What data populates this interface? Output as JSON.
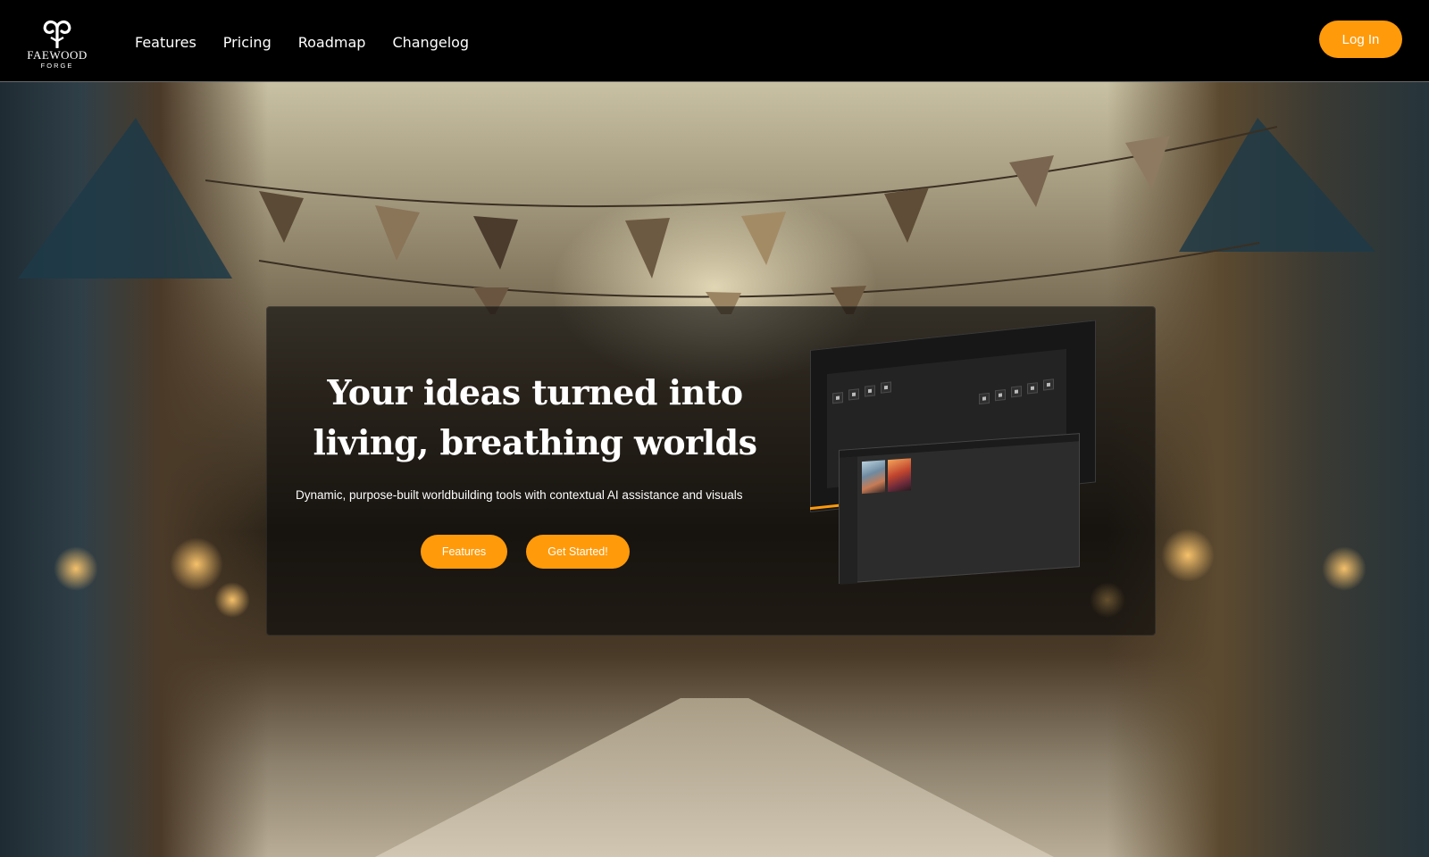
{
  "brand": {
    "name": "Faewood",
    "sub": "Forge"
  },
  "nav": {
    "links": [
      "Features",
      "Pricing",
      "Roadmap",
      "Changelog"
    ],
    "login_label": "Log In"
  },
  "hero": {
    "headline": "Your ideas turned into living, breathing worlds",
    "subheadline": "Dynamic, purpose-built worldbuilding tools with contextual AI assistance and visuals",
    "features_button": "Features",
    "cta_button": "Get Started!"
  },
  "colors": {
    "accent": "#ff9a0a",
    "nav_bg": "#000000",
    "card_bg": "rgba(10,10,10,0.62)"
  }
}
